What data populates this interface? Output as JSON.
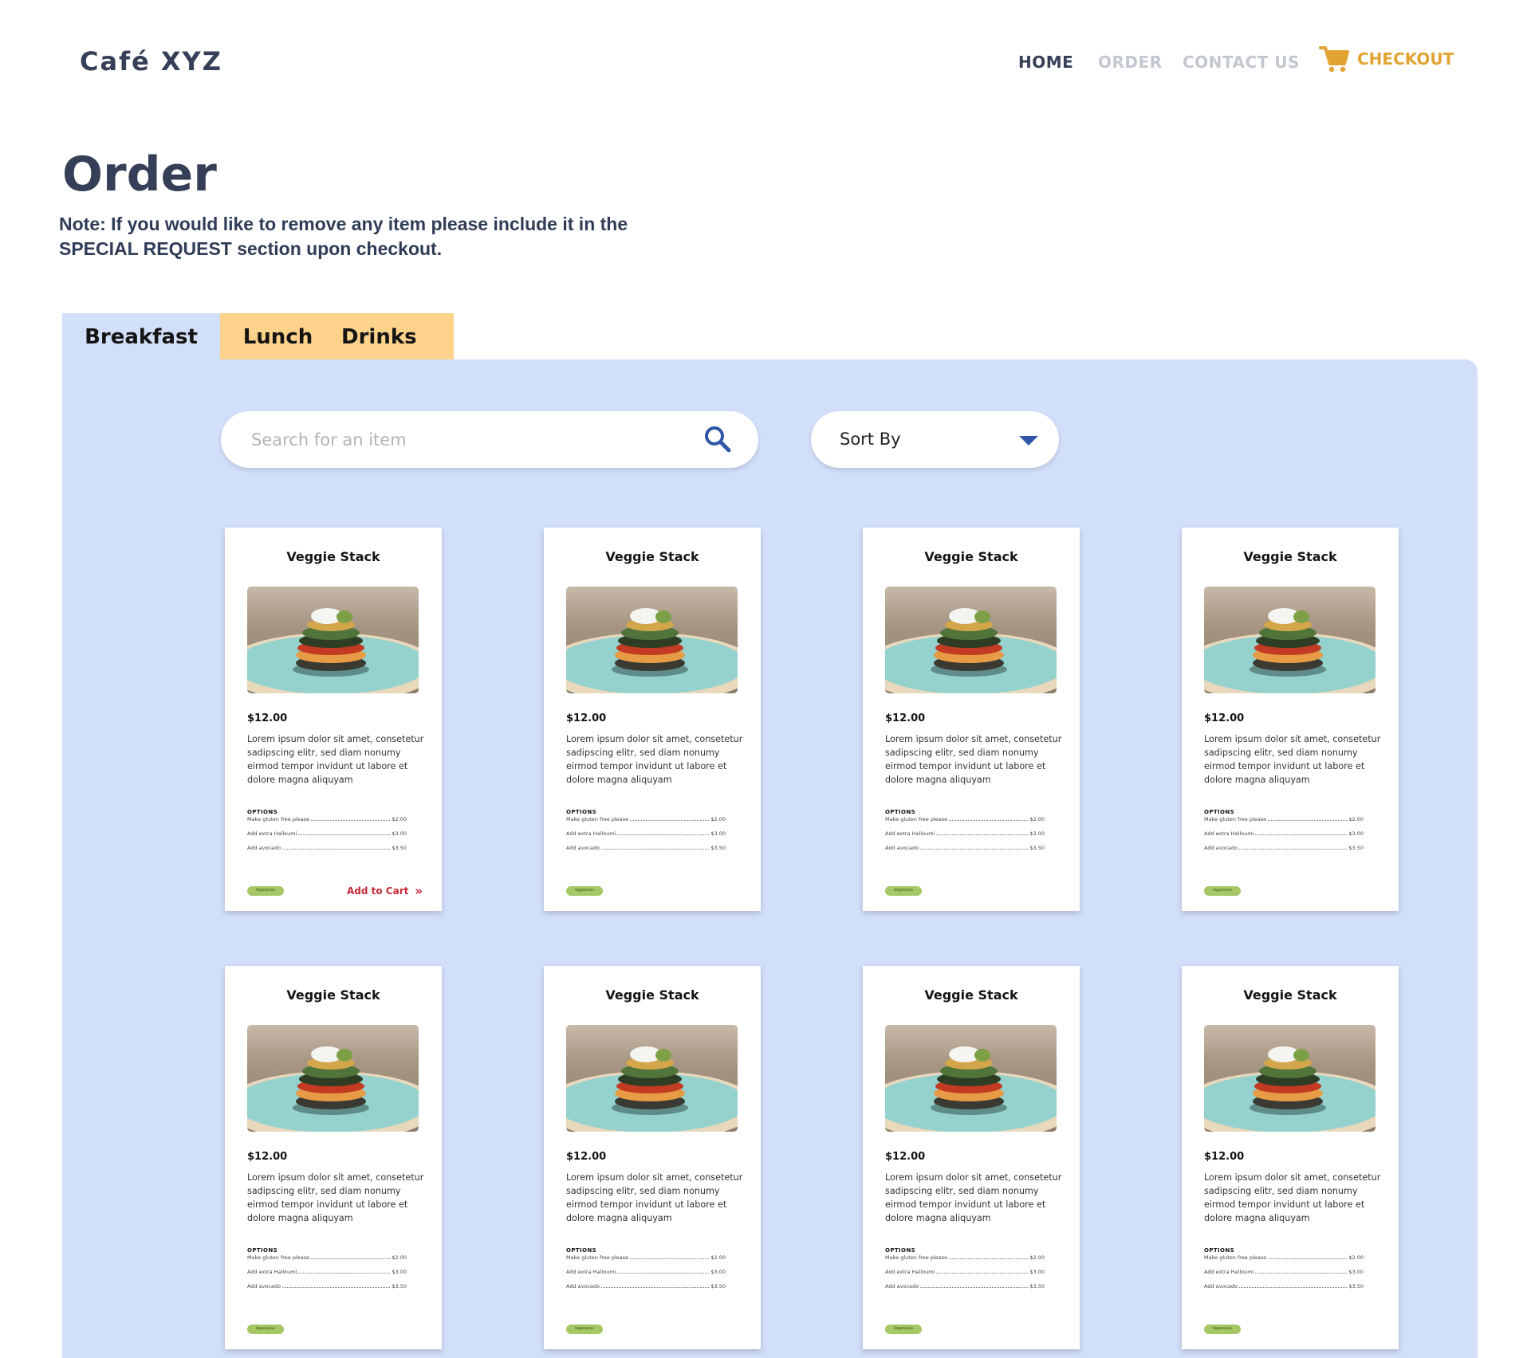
{
  "header": {
    "logo": "Café XYZ",
    "nav": {
      "home": "HOME",
      "order": "ORDER",
      "contact": "CONTACT US",
      "checkout": "CHECKOUT"
    },
    "colors": {
      "active": "#353f57",
      "inactive": "#c3c7d0",
      "checkout": "#e2a333"
    }
  },
  "page": {
    "title": "Order",
    "note": "Note: If you would like to remove any item please include it in the SPECIAL REQUEST section upon checkout."
  },
  "tabs": [
    {
      "label": "Breakfast",
      "active": true
    },
    {
      "label": "Lunch",
      "active": false
    },
    {
      "label": "Drinks",
      "active": false
    }
  ],
  "search": {
    "placeholder": "Search for an item",
    "icon": "search-icon"
  },
  "sort": {
    "label": "Sort By",
    "icon": "caret-down-icon"
  },
  "options_heading": "OPTIONS",
  "add_to_cart_label": "Add to Cart",
  "items": [
    {
      "title": "Veggie Stack",
      "price": "$12.00",
      "description": "Lorem ipsum dolor sit amet, consetetur sadipscing elitr, sed diam nonumy eirmod tempor invidunt ut labore et dolore magna aliquyam",
      "options": [
        {
          "name": "Make gluten free please",
          "price": "$2.00"
        },
        {
          "name": "Add extra Halloumi",
          "price": "$3.00"
        },
        {
          "name": "Add avocado",
          "price": "$3.50"
        }
      ],
      "badge": "Vegetarian",
      "show_add_to_cart": true
    },
    {
      "title": "Veggie Stack",
      "price": "$12.00",
      "description": "Lorem ipsum dolor sit amet, consetetur sadipscing elitr, sed diam nonumy eirmod tempor invidunt ut labore et dolore magna aliquyam",
      "options": [
        {
          "name": "Make gluten free please",
          "price": "$2.00"
        },
        {
          "name": "Add extra Halloumi",
          "price": "$3.00"
        },
        {
          "name": "Add avocado",
          "price": "$3.50"
        }
      ],
      "badge": "Vegetarian",
      "show_add_to_cart": false
    },
    {
      "title": "Veggie Stack",
      "price": "$12.00",
      "description": "Lorem ipsum dolor sit amet, consetetur sadipscing elitr, sed diam nonumy eirmod tempor invidunt ut labore et dolore magna aliquyam",
      "options": [
        {
          "name": "Make gluten free please",
          "price": "$2.00"
        },
        {
          "name": "Add extra Halloumi",
          "price": "$3.00"
        },
        {
          "name": "Add avocado",
          "price": "$3.50"
        }
      ],
      "badge": "Vegetarian",
      "show_add_to_cart": false
    },
    {
      "title": "Veggie Stack",
      "price": "$12.00",
      "description": "Lorem ipsum dolor sit amet, consetetur sadipscing elitr, sed diam nonumy eirmod tempor invidunt ut labore et dolore magna aliquyam",
      "options": [
        {
          "name": "Make gluten free please",
          "price": "$2.00"
        },
        {
          "name": "Add extra Halloumi",
          "price": "$3.00"
        },
        {
          "name": "Add avocado",
          "price": "$3.50"
        }
      ],
      "badge": "Vegetarian",
      "show_add_to_cart": false
    },
    {
      "title": "Veggie Stack",
      "price": "$12.00",
      "description": "Lorem ipsum dolor sit amet, consetetur sadipscing elitr, sed diam nonumy eirmod tempor invidunt ut labore et dolore magna aliquyam",
      "options": [
        {
          "name": "Make gluten free please",
          "price": "$2.00"
        },
        {
          "name": "Add extra Halloumi",
          "price": "$3.00"
        },
        {
          "name": "Add avocado",
          "price": "$3.50"
        }
      ],
      "badge": "Vegetarian",
      "show_add_to_cart": false
    },
    {
      "title": "Veggie Stack",
      "price": "$12.00",
      "description": "Lorem ipsum dolor sit amet, consetetur sadipscing elitr, sed diam nonumy eirmod tempor invidunt ut labore et dolore magna aliquyam",
      "options": [
        {
          "name": "Make gluten free please",
          "price": "$2.00"
        },
        {
          "name": "Add extra Halloumi",
          "price": "$3.00"
        },
        {
          "name": "Add avocado",
          "price": "$3.50"
        }
      ],
      "badge": "Vegetarian",
      "show_add_to_cart": false
    },
    {
      "title": "Veggie Stack",
      "price": "$12.00",
      "description": "Lorem ipsum dolor sit amet, consetetur sadipscing elitr, sed diam nonumy eirmod tempor invidunt ut labore et dolore magna aliquyam",
      "options": [
        {
          "name": "Make gluten free please",
          "price": "$2.00"
        },
        {
          "name": "Add extra Halloumi",
          "price": "$3.00"
        },
        {
          "name": "Add avocado",
          "price": "$3.50"
        }
      ],
      "badge": "Vegetarian",
      "show_add_to_cart": false
    },
    {
      "title": "Veggie Stack",
      "price": "$12.00",
      "description": "Lorem ipsum dolor sit amet, consetetur sadipscing elitr, sed diam nonumy eirmod tempor invidunt ut labore et dolore magna aliquyam",
      "options": [
        {
          "name": "Make gluten free please",
          "price": "$2.00"
        },
        {
          "name": "Add extra Halloumi",
          "price": "$3.00"
        },
        {
          "name": "Add avocado",
          "price": "$3.50"
        }
      ],
      "badge": "Vegetarian",
      "show_add_to_cart": false
    }
  ]
}
